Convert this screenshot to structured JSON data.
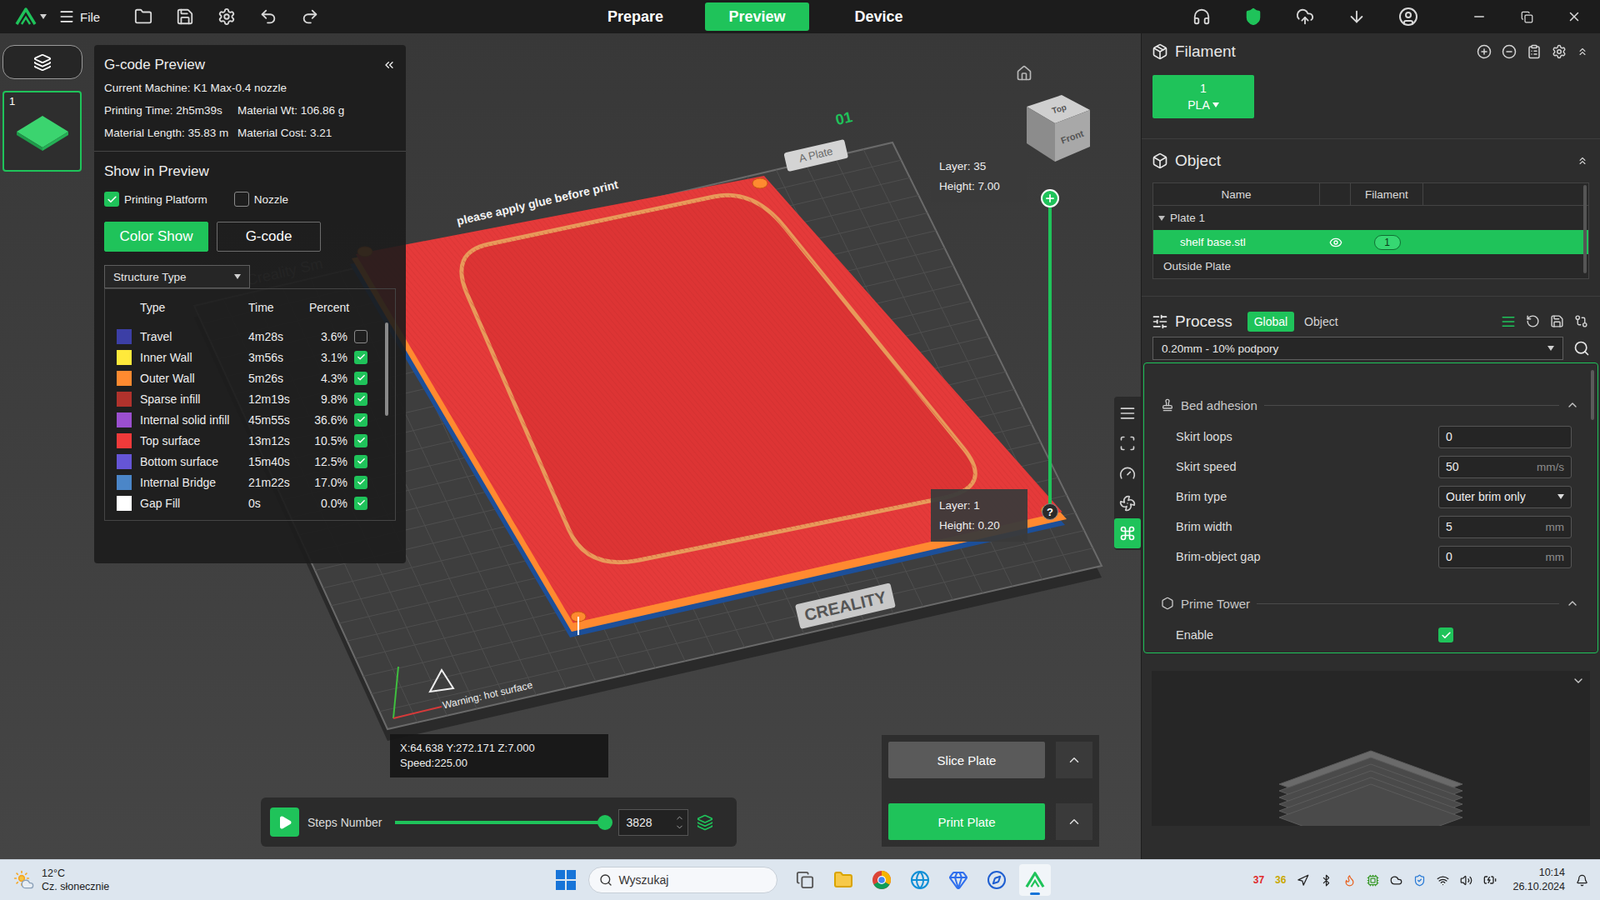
{
  "top_bar": {
    "menu_label": "File",
    "tabs": [
      {
        "label": "Prepare",
        "selected": false
      },
      {
        "label": "Preview",
        "selected": true
      },
      {
        "label": "Device",
        "selected": false
      }
    ]
  },
  "plates": [
    {
      "number": "1",
      "selected": true
    }
  ],
  "gcode_preview": {
    "title": "G-code Preview",
    "machine": "Current Machine: K1 Max-0.4 nozzle",
    "stats": [
      "Printing Time: 2h5m39s",
      "Material Wt: 106.86 g",
      "Material Length: 35.83 m",
      "Material Cost: 3.21"
    ],
    "show_in_preview": {
      "title": "Show in Preview",
      "options": [
        {
          "label": "Printing Platform",
          "checked": true
        },
        {
          "label": "Nozzle",
          "checked": false
        }
      ]
    },
    "modes": [
      {
        "label": "Color Show",
        "selected": true
      },
      {
        "label": "G-code",
        "selected": false
      }
    ],
    "view_type": "Structure Type",
    "columns": [
      "Type",
      "Time",
      "Percent"
    ],
    "rows": [
      {
        "type": "Travel",
        "time": "4m28s",
        "percent": "3.6%",
        "color": "#3c3fa6",
        "checked": false
      },
      {
        "type": "Inner Wall",
        "time": "3m56s",
        "percent": "3.1%",
        "color": "#ffe93b",
        "checked": true
      },
      {
        "type": "Outer Wall",
        "time": "5m26s",
        "percent": "4.3%",
        "color": "#ff8a30",
        "checked": true
      },
      {
        "type": "Sparse infill",
        "time": "12m19s",
        "percent": "9.8%",
        "color": "#b0322c",
        "checked": true
      },
      {
        "type": "Internal solid infill",
        "time": "45m55s",
        "percent": "36.6%",
        "color": "#9b4fcf",
        "checked": true
      },
      {
        "type": "Top surface",
        "time": "13m12s",
        "percent": "10.5%",
        "color": "#f03a3a",
        "checked": true
      },
      {
        "type": "Bottom surface",
        "time": "15m40s",
        "percent": "12.5%",
        "color": "#6555d6",
        "checked": true
      },
      {
        "type": "Internal Bridge",
        "time": "21m22s",
        "percent": "17.0%",
        "color": "#4b86c8",
        "checked": true
      },
      {
        "type": "Gap Fill",
        "time": "0s",
        "percent": "0.0%",
        "color": "#ffffff",
        "checked": true
      }
    ]
  },
  "bed": {
    "labels": [
      "01",
      "A Plate",
      "please apply glue before print",
      "Creality Sm",
      "CREALITY",
      "Warning: hot surface"
    ]
  },
  "view_cube": {
    "top": "Top",
    "front": "Front"
  },
  "layer_slider": {
    "level": 1,
    "top": {
      "layer": "Layer: 35",
      "height": "Height: 7.00"
    },
    "bottom": {
      "layer": "Layer: 1",
      "height": "Height: 0.20"
    },
    "help": "?"
  },
  "position": {
    "coords": "X:64.638 Y:272.171 Z:7.000",
    "speed": "Speed:225.00"
  },
  "steps": {
    "label": "Steps Number",
    "value": "3828",
    "level": 1
  },
  "actions": [
    {
      "label": "Slice Plate",
      "primary": false
    },
    {
      "label": "Print Plate",
      "primary": true
    }
  ],
  "filament": {
    "title": "Filament",
    "slots": [
      {
        "number": "1",
        "material": "PLA",
        "color": "#1fc35a"
      }
    ]
  },
  "object": {
    "title": "Object",
    "columns": [
      "Name",
      "Filament"
    ],
    "plate": {
      "label": "Plate 1",
      "expanded": true
    },
    "items": [
      {
        "name": "shelf base.stl",
        "visible": true,
        "filament": "1",
        "selected": true
      }
    ],
    "outside": "Outside Plate"
  },
  "process": {
    "title": "Process",
    "scopes": [
      {
        "label": "Global",
        "selected": true
      },
      {
        "label": "Object",
        "selected": false
      }
    ],
    "preset": "0.20mm - 10% podpory",
    "groups": [
      {
        "title": "Bed adhesion",
        "expanded": true,
        "settings": [
          {
            "label": "Skirt loops",
            "kind": "number",
            "value": "0"
          },
          {
            "label": "Skirt speed",
            "kind": "number",
            "value": "50",
            "unit": "mm/s"
          },
          {
            "label": "Brim type",
            "kind": "select",
            "value": "Outer brim only"
          },
          {
            "label": "Brim width",
            "kind": "number",
            "value": "5",
            "unit": "mm"
          },
          {
            "label": "Brim-object gap",
            "kind": "number",
            "value": "0",
            "unit": "mm"
          }
        ]
      },
      {
        "title": "Prime Tower",
        "expanded": true,
        "settings": [
          {
            "label": "Enable",
            "kind": "checkbox",
            "checked": true
          }
        ]
      }
    ]
  },
  "taskbar": {
    "weather": {
      "temp": "12°C",
      "desc": "Cz. słonecznie"
    },
    "search": "Wyszukaj",
    "tray": [
      {
        "text": "37",
        "color": "#e02a2a"
      },
      {
        "text": "36",
        "color": "#c9a800"
      }
    ],
    "time": "10:14",
    "date": "26.10.2024"
  }
}
